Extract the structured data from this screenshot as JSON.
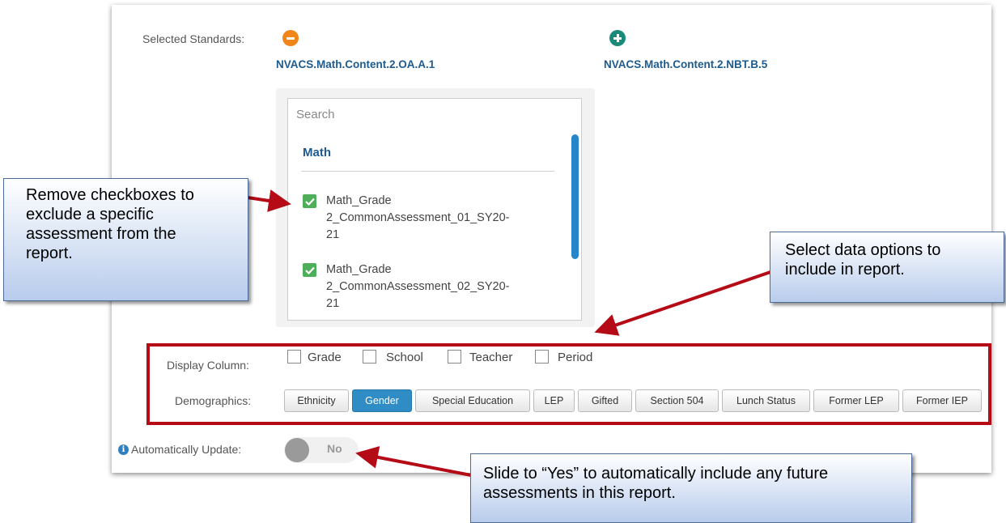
{
  "selected_standards": {
    "label": "Selected Standards:",
    "items": [
      {
        "code": "NVACS.Math.Content.2.OA.A.1",
        "action_icon": "minus-circle-icon",
        "color": "#f0851a"
      },
      {
        "code": "NVACS.Math.Content.2.NBT.B.5",
        "action_icon": "plus-circle-icon",
        "color": "#1a8a7a"
      }
    ]
  },
  "assessment_list": {
    "search_placeholder": "Search",
    "group_title": "Math",
    "items": [
      {
        "line1": "Math_Grade",
        "line2": "2_CommonAssessment_01_SY20-",
        "line3": "21",
        "checked": true
      },
      {
        "line1": "Math_Grade",
        "line2": "2_CommonAssessment_02_SY20-",
        "line3": "21",
        "checked": true
      }
    ]
  },
  "display_column": {
    "label": "Display Column:",
    "options": [
      "Grade",
      "School",
      "Teacher",
      "Period"
    ]
  },
  "demographics": {
    "label": "Demographics:",
    "buttons": [
      "Ethnicity",
      "Gender",
      "Special Education",
      "LEP",
      "Gifted",
      "Section 504",
      "Lunch Status",
      "Former LEP",
      "Former IEP"
    ],
    "active": "Gender"
  },
  "auto_update": {
    "label": "Automatically Update:",
    "info_icon": "info-icon",
    "toggle_value": "No"
  },
  "callouts": {
    "checkboxes": "Remove checkboxes to exclude a specific assessment from the report.",
    "data_options": "Select data options to include in report.",
    "auto_update": "Slide to “Yes” to automatically include any future assessments in this report."
  },
  "colors": {
    "accent_blue": "#2f8cc4",
    "highlight_red": "#b50b17",
    "check_green": "#4fae5a"
  }
}
